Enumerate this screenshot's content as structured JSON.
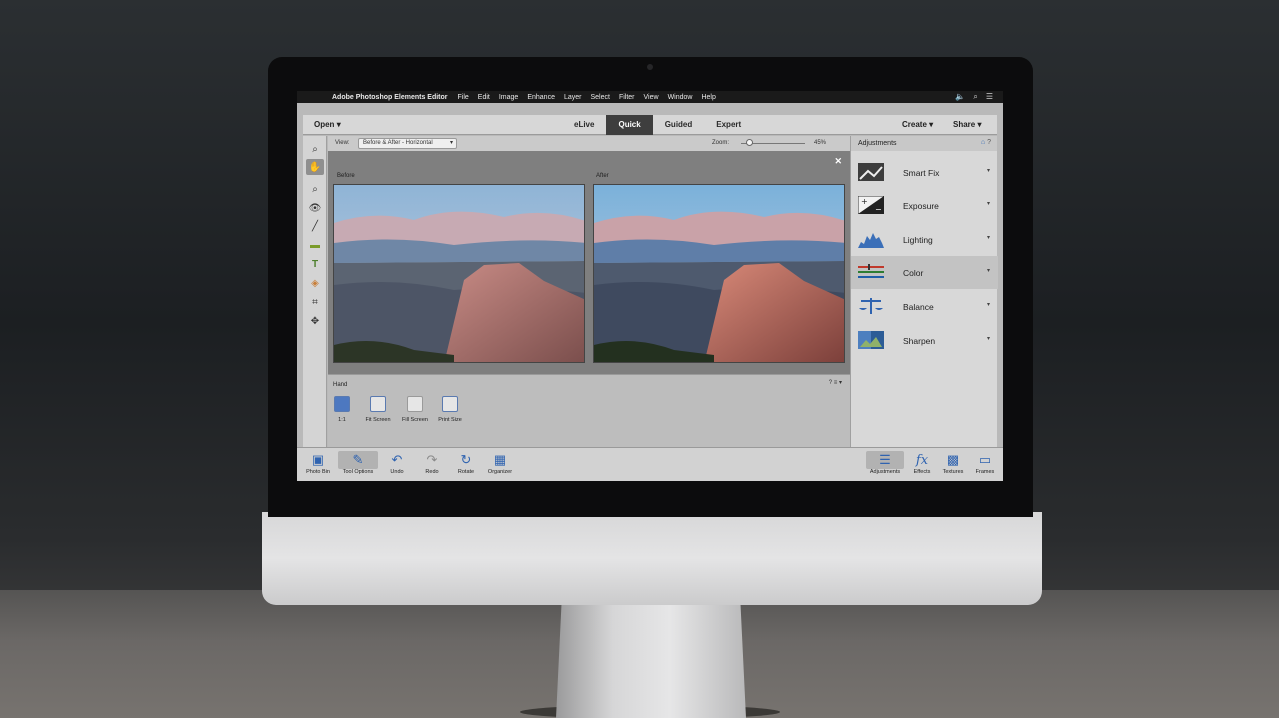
{
  "menubar": {
    "app_title": "Adobe Photoshop Elements Editor",
    "items": [
      "File",
      "Edit",
      "Image",
      "Enhance",
      "Layer",
      "Select",
      "Filter",
      "View",
      "Window",
      "Help"
    ]
  },
  "topbar": {
    "open": "Open",
    "modes": [
      "eLive",
      "Quick",
      "Guided",
      "Expert"
    ],
    "active_mode": "Quick",
    "create": "Create",
    "share": "Share"
  },
  "viewbar": {
    "view_label": "View:",
    "view_value": "Before & After - Horizontal",
    "zoom_label": "Zoom:",
    "zoom_value": "45%"
  },
  "canvas": {
    "before_label": "Before",
    "after_label": "After"
  },
  "tool_options": {
    "tool_name": "Hand",
    "options": [
      "1:1",
      "Fit Screen",
      "Fill Screen",
      "Print Size"
    ]
  },
  "adjustments": {
    "title": "Adjustments",
    "items": [
      "Smart Fix",
      "Exposure",
      "Lighting",
      "Color",
      "Balance",
      "Sharpen"
    ],
    "active_item": "Color"
  },
  "taskbar": {
    "left": [
      "Photo Bin",
      "Tool Options",
      "Undo",
      "Redo",
      "Rotate",
      "Organizer"
    ],
    "right": [
      "Adjustments",
      "Effects",
      "Textures",
      "Frames"
    ]
  },
  "colors": {
    "accent_blue": "#2f63b0",
    "active_tab": "#3e3e3e"
  }
}
